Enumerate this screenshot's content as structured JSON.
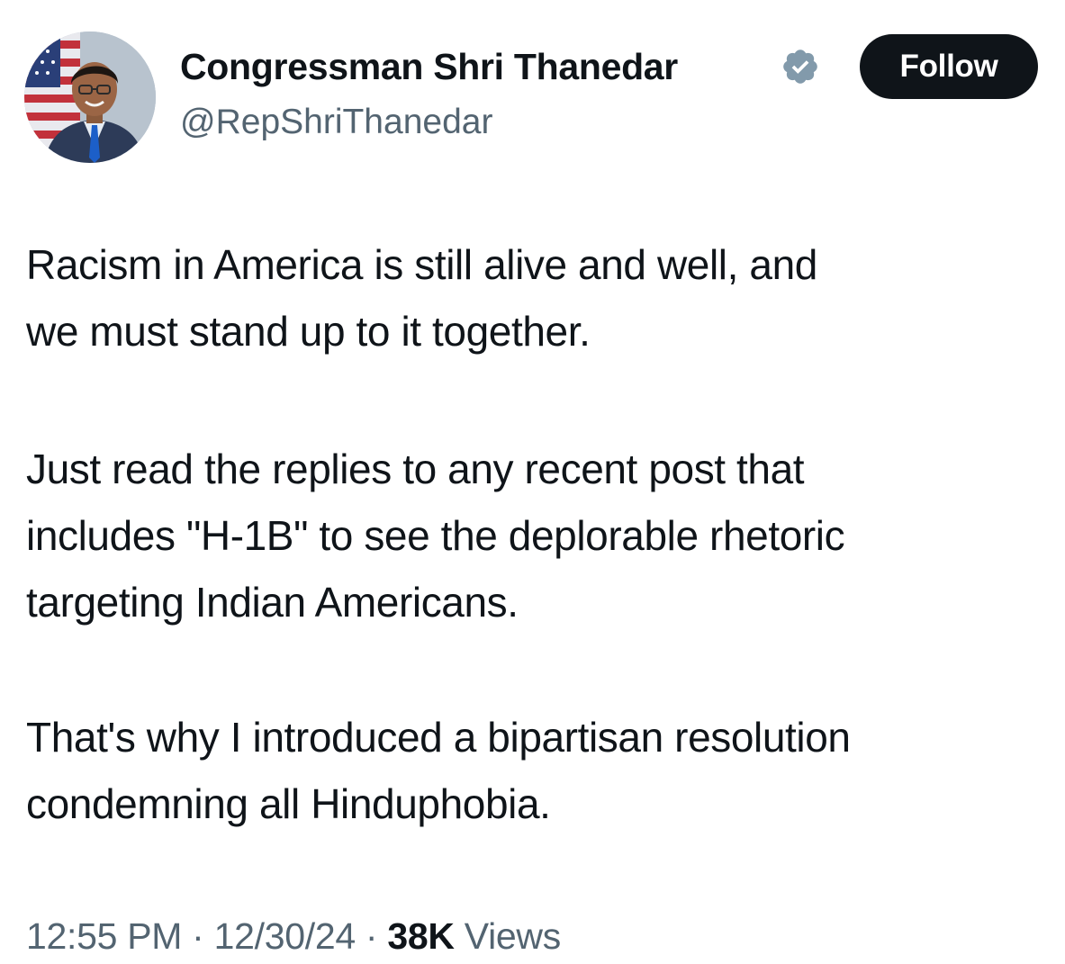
{
  "author": {
    "display_name": "Congressman Shri Thanedar",
    "handle": "@RepShriThanedar",
    "verified_icon": "verified-badge-gray",
    "avatar_icon": "profile-photo"
  },
  "follow_button": {
    "label": "Follow"
  },
  "tweet": {
    "paragraphs": [
      [
        "Racism in America is still alive and well, and",
        "we must stand up to it together."
      ],
      [
        "Just read the replies to any recent post that",
        "includes \"H-1B\" to see the deplorable rhetoric",
        "targeting Indian Americans."
      ],
      [
        "That's why I introduced a bipartisan resolution",
        "condemning all Hinduphobia."
      ]
    ]
  },
  "meta": {
    "time": "12:55 PM",
    "separator": " · ",
    "date": "12/30/24",
    "views_count": "38K",
    "views_label": " Views"
  },
  "colors": {
    "text_primary": "#0f1419",
    "text_secondary": "#536471",
    "button_bg": "#0f1419",
    "verified_badge": "#829aab"
  }
}
